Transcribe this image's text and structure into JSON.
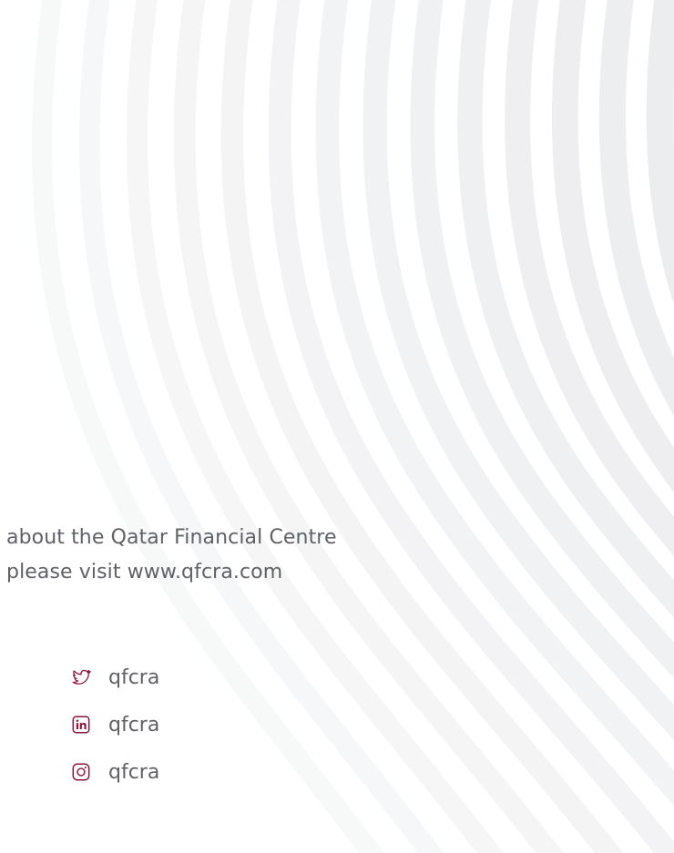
{
  "info": {
    "line1": "about the Qatar Financial Centre",
    "line2": "please visit www.qfcra.com"
  },
  "social": {
    "accent_color": "#8a1538",
    "items": [
      {
        "icon": "twitter-icon",
        "handle": "qfcra"
      },
      {
        "icon": "linkedin-icon",
        "handle": "qfcra"
      },
      {
        "icon": "instagram-icon",
        "handle": "qfcra"
      }
    ]
  }
}
